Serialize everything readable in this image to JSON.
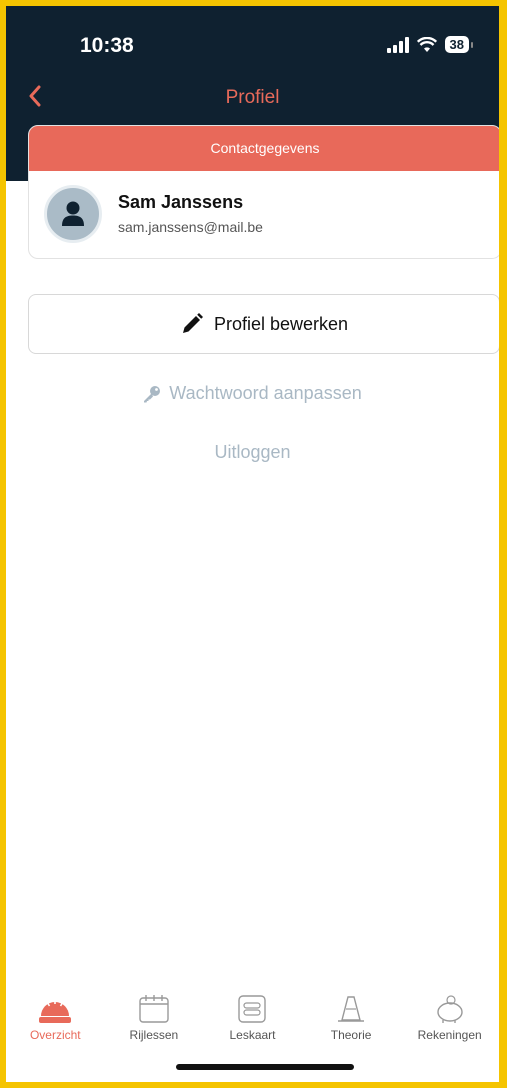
{
  "status_bar": {
    "time": "10:38",
    "battery": "38"
  },
  "nav": {
    "back_icon": "chevron-left-icon",
    "title": "Profiel"
  },
  "contact": {
    "header": "Contactgegevens",
    "name": "Sam Janssens",
    "email": "sam.janssens@mail.be",
    "avatar_icon": "user-icon"
  },
  "actions": {
    "edit_label": "Profiel bewerken",
    "edit_icon": "pencil-icon",
    "password_label": "Wachtwoord aanpassen",
    "password_icon": "key-icon",
    "logout_label": "Uitloggen"
  },
  "tabs": [
    {
      "label": "Overzicht",
      "icon": "sunrise-icon",
      "active": true
    },
    {
      "label": "Rijlessen",
      "icon": "calendar-icon",
      "active": false
    },
    {
      "label": "Leskaart",
      "icon": "card-icon",
      "active": false
    },
    {
      "label": "Theorie",
      "icon": "traffic-cone-icon",
      "active": false
    },
    {
      "label": "Rekeningen",
      "icon": "piggy-bank-icon",
      "active": false
    }
  ],
  "colors": {
    "accent": "#e86a5a",
    "header_bg": "#0f2130",
    "muted": "#a9b8c4"
  }
}
